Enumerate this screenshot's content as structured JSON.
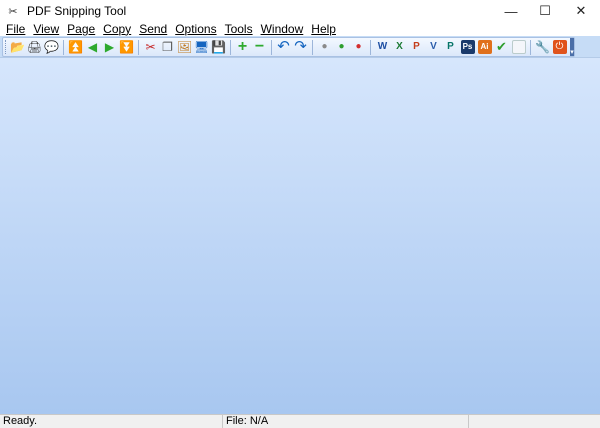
{
  "window": {
    "title": "PDF Snipping Tool",
    "app_icon": "scissors-icon",
    "controls": {
      "minimize": "—",
      "maximize": "☐",
      "close": "✕"
    }
  },
  "menu": {
    "items": [
      "File",
      "View",
      "Page",
      "Copy",
      "Send",
      "Options",
      "Tools",
      "Window",
      "Help"
    ]
  },
  "toolbar": {
    "buttons": [
      {
        "name": "open-icon",
        "glyph": "📂"
      },
      {
        "name": "print-icon",
        "glyph": "🖨"
      },
      {
        "name": "comment-icon",
        "glyph": "💬"
      },
      {
        "name": "first-page-icon",
        "glyph": "⏫"
      },
      {
        "name": "previous-page-icon",
        "glyph": "◀"
      },
      {
        "name": "next-page-icon",
        "glyph": "▶"
      },
      {
        "name": "last-page-icon",
        "glyph": "⏬"
      },
      {
        "name": "snip-icon",
        "glyph": "✂"
      },
      {
        "name": "copy-icon",
        "glyph": "❐"
      },
      {
        "name": "image-icon",
        "glyph": "🖼"
      },
      {
        "name": "screen-icon",
        "glyph": "🖥"
      },
      {
        "name": "save-icon",
        "glyph": "💾"
      },
      {
        "name": "zoom-in-icon",
        "glyph": "+"
      },
      {
        "name": "zoom-out-icon",
        "glyph": "−"
      },
      {
        "name": "undo-icon",
        "glyph": "↶"
      },
      {
        "name": "redo-icon",
        "glyph": "↷"
      },
      {
        "name": "gray-dot-icon",
        "glyph": "●"
      },
      {
        "name": "green-dot-icon",
        "glyph": "●"
      },
      {
        "name": "red-dot-icon",
        "glyph": "●"
      },
      {
        "name": "word-icon",
        "glyph": "W"
      },
      {
        "name": "excel-icon",
        "glyph": "X"
      },
      {
        "name": "powerpoint-icon",
        "glyph": "P"
      },
      {
        "name": "visio-icon",
        "glyph": "V"
      },
      {
        "name": "publisher-icon",
        "glyph": "P"
      },
      {
        "name": "photoshop-icon",
        "glyph": "Ps"
      },
      {
        "name": "illustrator-icon",
        "glyph": "Ai"
      },
      {
        "name": "check-icon",
        "glyph": "✔"
      },
      {
        "name": "blank-icon",
        "glyph": ""
      },
      {
        "name": "tools-icon",
        "glyph": "🔧"
      },
      {
        "name": "exit-icon",
        "glyph": "⏻"
      }
    ]
  },
  "status": {
    "ready": "Ready.",
    "file": "File: N/A"
  },
  "colors": {
    "toolbar_bg": "#c6dcf6",
    "workspace_top": "#d6e6fc",
    "workspace_bottom": "#a8c7f0",
    "statusbar_bg": "#f0f0f0"
  }
}
